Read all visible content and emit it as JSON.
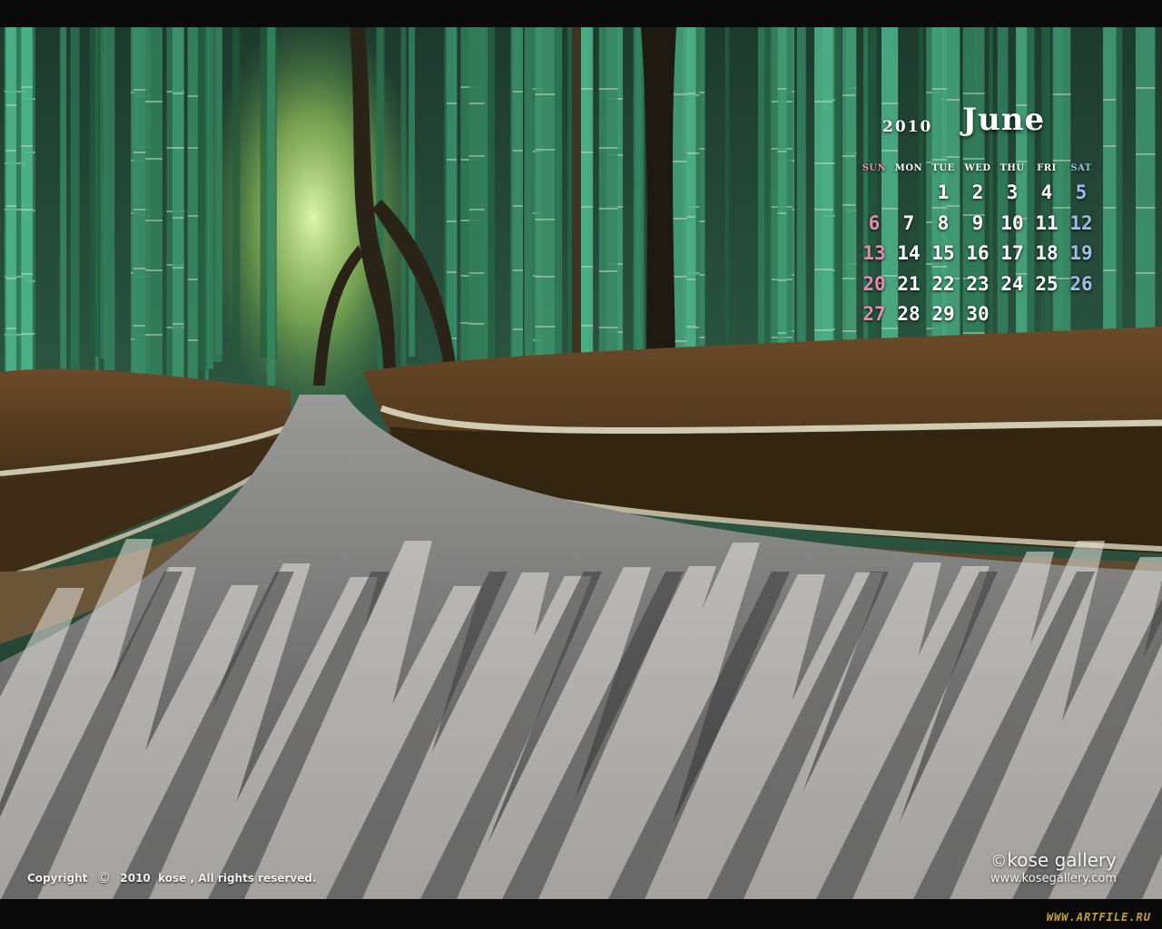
{
  "calendar": {
    "year": "2010",
    "month": "June",
    "weekdays": [
      "SUN",
      "MON",
      "TUE",
      "WED",
      "THU",
      "FRI",
      "SAT"
    ],
    "weeks": [
      [
        "",
        "",
        "1",
        "2",
        "3",
        "4",
        "5"
      ],
      [
        "6",
        "7",
        "8",
        "9",
        "10",
        "11",
        "12"
      ],
      [
        "13",
        "14",
        "15",
        "16",
        "17",
        "18",
        "19"
      ],
      [
        "20",
        "21",
        "22",
        "23",
        "24",
        "25",
        "26"
      ],
      [
        "27",
        "28",
        "29",
        "30",
        "",
        "",
        ""
      ]
    ],
    "colors": {
      "weekday": "#ffffff",
      "sunday": "#e58bb2",
      "saturday": "#9fbfe8"
    }
  },
  "footer": {
    "copyright_prefix": "Copyright",
    "copyright_symbol": "©",
    "copyright_text": "2010  kose , All rights reserved.",
    "brand_symbol": "©",
    "brand_name": "kose gallery",
    "brand_url": "www.kosegallery.com"
  },
  "watermark": "WWW.ARTFILE.RU"
}
